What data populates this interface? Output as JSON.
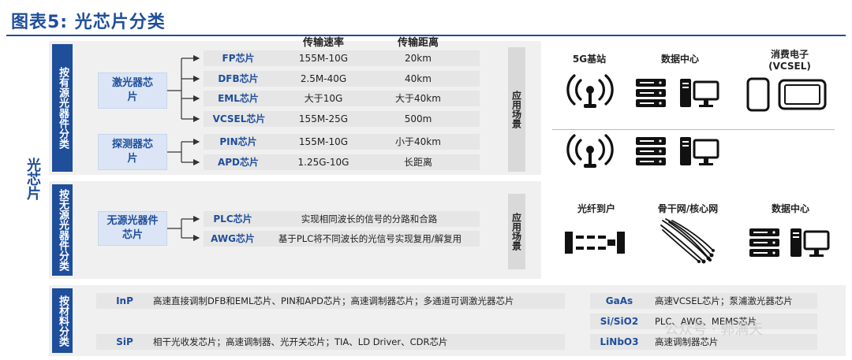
{
  "title": "图表5:  光芯片分类",
  "side_label": "光芯片",
  "active": {
    "category": "按有源光器件分类",
    "headers": {
      "rate": "传输速率",
      "distance": "传输距离"
    },
    "groups": [
      {
        "name": "激光器芯片",
        "items": [
          {
            "chip": "FP芯片",
            "rate": "155M-10G",
            "distance": "20km"
          },
          {
            "chip": "DFB芯片",
            "rate": "2.5M-40G",
            "distance": "40km"
          },
          {
            "chip": "EML芯片",
            "rate": "大于10G",
            "distance": "大于40km"
          },
          {
            "chip": "VCSEL芯片",
            "rate": "155M-25G",
            "distance": "500m"
          }
        ]
      },
      {
        "name": "探测器芯片",
        "items": [
          {
            "chip": "PIN芯片",
            "rate": "155M-10G",
            "distance": "小于40km"
          },
          {
            "chip": "APD芯片",
            "rate": "1.25G-10G",
            "distance": "长距离"
          }
        ]
      }
    ],
    "scene_label": "应用场景",
    "scenes": [
      {
        "label": "5G基站",
        "icon": "antenna-icon"
      },
      {
        "label": "数据中心",
        "icon": "server-icon"
      },
      {
        "label": "消费电子\n(VCSEL)",
        "icon": "phone-tablet-icon"
      }
    ]
  },
  "passive": {
    "category": "按无源光器件分类",
    "group": "无源光器件芯片",
    "items": [
      {
        "chip": "PLC芯片",
        "desc": "实现相同波长的信号的分路和合路"
      },
      {
        "chip": "AWG芯片",
        "desc": "基于PLC将不同波长的光信号实现复用/解复用"
      }
    ],
    "scene_label": "应用场景",
    "scenes": [
      {
        "label": "光纤到户",
        "icon": "fiber-connector-icon"
      },
      {
        "label": "骨干网/核心网",
        "icon": "fiber-bundle-icon"
      },
      {
        "label": "数据中心",
        "icon": "server-icon"
      }
    ]
  },
  "material": {
    "category": "按材料分类",
    "left": [
      {
        "name": "InP",
        "desc": "高速直接调制DFB和EML芯片、PIN和APD芯片；高速调制器芯片；多通道可调激光器芯片"
      },
      {
        "name": "SiP",
        "desc": "相干光收发芯片；高速调制器、光开关芯片；TIA、LD Driver、CDR芯片"
      }
    ],
    "right": [
      {
        "name": "GaAs",
        "desc": "高速VCSEL芯片；泵浦激光器芯片"
      },
      {
        "name": "Si/SiO2",
        "desc": "PLC、AWG、MEMS芯片"
      },
      {
        "name": "LiNbO3",
        "desc": "高速调制器芯片"
      }
    ]
  },
  "watermark": "公众号 · 郭满天"
}
